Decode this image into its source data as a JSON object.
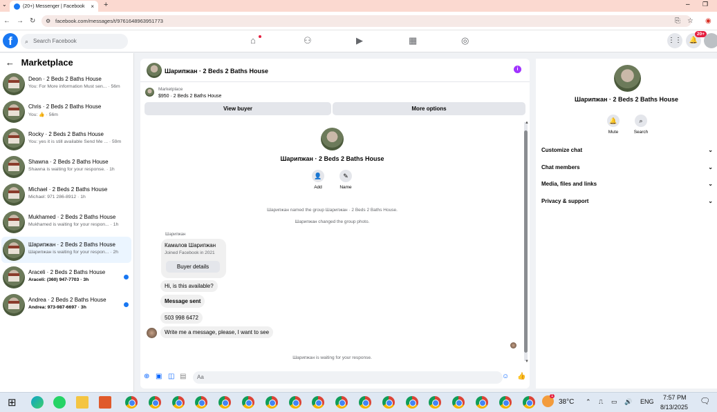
{
  "browser": {
    "tab_title": "(20+) Messenger | Facebook",
    "url": "facebook.com/messages/t/9761648963951773",
    "new_tab": "+",
    "tab_close": "×"
  },
  "fbnav": {
    "logo": "f",
    "search_placeholder": "Search Facebook",
    "badge": "20+"
  },
  "sidebar": {
    "title": "Marketplace",
    "conversations": [
      {
        "title": "Deon · 2 Beds 2 Baths House",
        "sub": "You: For More information Must sen... · 56m",
        "unread": false
      },
      {
        "title": "Chris · 2 Beds 2 Baths House",
        "sub": "You: 👍 · 56m",
        "unread": false
      },
      {
        "title": "Rocky · 2 Beds 2 Baths House",
        "sub": "You: yes it is still available Send Me ... · 59m",
        "unread": false
      },
      {
        "title": "Shawna · 2 Beds 2 Baths House",
        "sub": "Shawna is waiting for your response. · 1h",
        "unread": false
      },
      {
        "title": "Michael · 2 Beds 2 Baths House",
        "sub": "Michael: 971 286-8912 · 1h",
        "unread": false
      },
      {
        "title": "Mukhamed · 2 Beds 2 Baths House",
        "sub": "Mukhamed is waiting for your respon... · 1h",
        "unread": false
      },
      {
        "title": "Шарипжан · 2 Beds 2 Baths House",
        "sub": "Шарипжан is waiting for your respon... · 2h",
        "unread": false
      },
      {
        "title": "Araceli · 2 Beds 2 Baths House",
        "sub": "Araceli: (360) 947-7703 · 3h",
        "unread": true
      },
      {
        "title": "Andrea · 2 Beds 2 Baths House",
        "sub": "Andrea: 973-987-6697 · 3h",
        "unread": true
      }
    ]
  },
  "chat": {
    "header_title": "Шарипжан · 2 Beds 2 Baths House",
    "info_icon": "i",
    "listing_source": "Marketplace",
    "listing_price": "$950 · 2 Beds 2 Baths House",
    "view_buyer": "View buyer",
    "more_options": "More options",
    "group_title": "Шарипжан · 2 Beds 2 Baths House",
    "add_label": "Add",
    "name_label": "Name",
    "event1": "Шарипжан named the group Шарипжан · 2 Beds 2 Baths House.",
    "event2": "Шарипжан changed the group photo.",
    "sender_name": "Шарипжан",
    "card_name": "Камалов Шарипжан",
    "card_joined": "Joined Facebook in 2021",
    "buyer_details": "Buyer details",
    "msg1": "Hi, is this available?",
    "msg2": "Message sent",
    "msg3": "503 998 6472",
    "msg4": "Write me a message, please, I want to see",
    "waiting": "Шарипжан is waiting for your response.",
    "composer_placeholder": "Aa"
  },
  "rpanel": {
    "title": "Шарипжан · 2 Beds 2 Baths House",
    "mute": "Mute",
    "search": "Search",
    "items": [
      "Customize chat",
      "Chat members",
      "Media, files and links",
      "Privacy & support"
    ]
  },
  "taskbar": {
    "temperature": "38°C",
    "language": "ENG",
    "time": "7:57 PM",
    "date": "8/13/2025",
    "weather_badge": "1"
  }
}
